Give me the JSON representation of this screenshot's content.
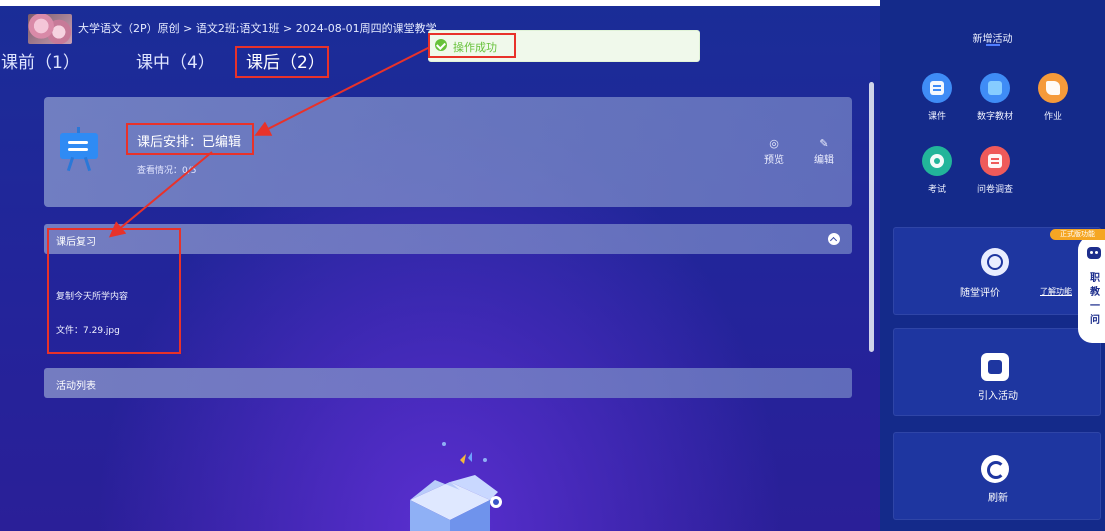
{
  "header": {
    "breadcrumb": "大学语文（2P）原创 > 语文2班;语文1班 > 2024-08-01周四的课堂教学"
  },
  "tabs": [
    {
      "label": "课前（1）"
    },
    {
      "label": "课中（4）"
    },
    {
      "label": "课后（2）"
    }
  ],
  "toast": {
    "message": "操作成功"
  },
  "card": {
    "title": "课后安排：已编辑",
    "subtitle": "查看情况：0/5",
    "preview_label": "预览",
    "edit_label": "编辑",
    "preview_icon": "eye-icon",
    "edit_icon": "pencil-icon"
  },
  "review": {
    "title": "课后复习",
    "content": "复制今天所学内容",
    "file": "文件：7.29.jpg"
  },
  "activity_list": {
    "title": "活动列表"
  },
  "sidebar": {
    "title": "新增活动",
    "tools": [
      {
        "label": "课件",
        "icon": "courseware-icon",
        "color": "#3f8cf6"
      },
      {
        "label": "数字教材",
        "icon": "digital-book-icon",
        "color": "#3f8cf6"
      },
      {
        "label": "作业",
        "icon": "homework-icon",
        "color": "#f59a3a"
      },
      {
        "label": "考试",
        "icon": "exam-icon",
        "color": "#22b59a"
      },
      {
        "label": "问卷调查",
        "icon": "survey-icon",
        "color": "#ef5a5a"
      }
    ],
    "evaluation": {
      "label": "随堂评价",
      "link": "了解功能"
    },
    "import": {
      "label": "引入活动"
    },
    "refresh": {
      "label": "刷新"
    }
  },
  "assistant": {
    "badge": "正式版功能",
    "text": "职教一问"
  },
  "colors": {
    "highlight": "#e8322a",
    "success": "#67c23a",
    "accent": "#4f7dff"
  }
}
